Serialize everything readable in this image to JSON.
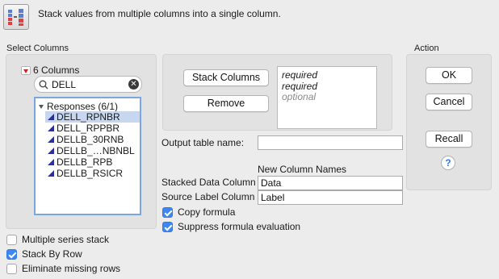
{
  "header": {
    "icon": "stack-icon",
    "text": "Stack values from multiple columns into a single column."
  },
  "select_columns": {
    "title": "Select Columns",
    "count_label": "6 Columns",
    "search_value": "DELL",
    "group_label": "Responses (6/1)",
    "items": [
      "DELL_RPNBR",
      "DELL_RPPBR",
      "DELLB_30RNB",
      "DELLB_…NBNBL",
      "DELLB_RPB",
      "DELLB_RSICR"
    ],
    "selected_index": 0
  },
  "roles": {
    "stack_button": "Stack Columns",
    "remove_button": "Remove",
    "slots": [
      "required",
      "required",
      "optional"
    ]
  },
  "output": {
    "table_name_label": "Output table name:",
    "table_name_value": "",
    "new_column_names_label": "New Column Names",
    "stacked_label": "Stacked Data Column",
    "stacked_value": "Data",
    "source_label": "Source Label Column",
    "source_value": "Label"
  },
  "options": {
    "copy_formula": {
      "label": "Copy formula",
      "checked": true
    },
    "suppress_formula": {
      "label": "Suppress formula evaluation",
      "checked": true
    },
    "multiple_series": {
      "label": "Multiple series stack",
      "checked": false
    },
    "stack_by_row": {
      "label": "Stack By Row",
      "checked": true
    },
    "eliminate_missing": {
      "label": "Eliminate missing rows",
      "checked": false
    }
  },
  "action": {
    "title": "Action",
    "ok": "OK",
    "cancel": "Cancel",
    "recall": "Recall",
    "help": "?"
  },
  "colors": {
    "accent": "#3b88f5",
    "selection": "#c7d7ef",
    "list_border": "#7ba7e1",
    "column_icon": "#2c2f9a",
    "red_toggle": "#d02020"
  }
}
